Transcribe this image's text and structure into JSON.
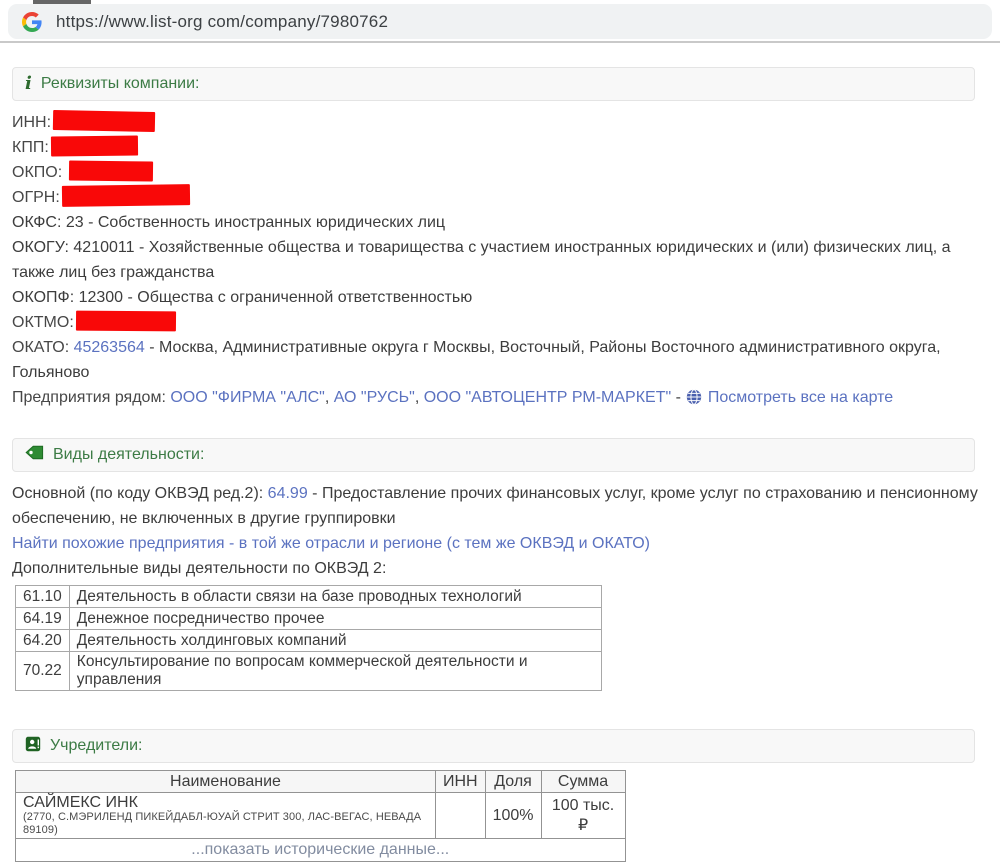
{
  "browser": {
    "url": "https://www.list-org com/company/7980762"
  },
  "requisites": {
    "title": "Реквизиты компании:",
    "redacted": [
      {
        "label": "ИНН:"
      },
      {
        "label": "КПП:"
      },
      {
        "label": "ОКПО: "
      },
      {
        "label": "ОГРН:"
      }
    ],
    "okfs": "ОКФС: 23 - Собственность иностранных юридических лиц",
    "okogu": "ОКОГУ: 4210011 - Хозяйственные общества и товарищества с участием иностранных юридических и (или) физических лиц, а также лиц без гражданства",
    "okopf": "ОКОПФ: 12300 - Общества с ограниченной ответственностью",
    "oktmo_label": "ОКТМО:",
    "okato": {
      "label": "ОКАТО: ",
      "code": "45263564",
      "rest": " - Москва, Административные округа г Москвы, Восточный, Районы Восточного административного округа, Гольяново"
    },
    "nearby": {
      "label": "Предприятия рядом: ",
      "links": [
        "ООО \"ФИРМА \"АЛС\"",
        "АО \"РУСЬ\"",
        "ООО \"АВТОЦЕНТР РМ-МАРКЕТ\""
      ],
      "comma": ", ",
      "dash": " - ",
      "map_link": "Посмотреть все на карте"
    }
  },
  "activities": {
    "title": "Виды деятельности:",
    "main_prefix": "Основной (по коду ОКВЭД ред.2): ",
    "main_code": "64.99",
    "main_rest": " - Предоставление прочих финансовых услуг, кроме услуг по страхованию и пенсионному обеспечению, не включенных в другие группировки",
    "similar_link": "Найти похожие предприятия - в той же отрасли и регионе (с тем же ОКВЭД и ОКАТО)",
    "additional_label": "Дополнительные виды деятельности по ОКВЭД 2:",
    "okved_rows": [
      {
        "code": "61.10",
        "name": "Деятельность в области связи на базе проводных технологий"
      },
      {
        "code": "64.19",
        "name": "Денежное посредничество прочее"
      },
      {
        "code": "64.20",
        "name": "Деятельность холдинговых компаний"
      },
      {
        "code": "70.22",
        "name": "Консультирование по вопросам коммерческой деятельности и управления"
      }
    ]
  },
  "founders": {
    "title": "Учредители:",
    "headers": [
      "Наименование",
      "ИНН",
      "Доля",
      "Сумма"
    ],
    "rows": [
      {
        "name": "САЙМЕКС ИНК",
        "address": "(2770, С.МЭРИЛЕНД ПИКЕЙДАБЛ-ЮУАЙ СТРИТ 300, ЛАС-ВЕГАС, НЕВАДА 89109)",
        "inn": "",
        "share": "100%",
        "sum": "100 тыс.₽"
      }
    ],
    "history_link": "...показать исторические данные..."
  },
  "colors": {
    "accent_green": "#3c7b45",
    "link_blue": "#5b72c0",
    "redaction_red": "#f90808"
  }
}
